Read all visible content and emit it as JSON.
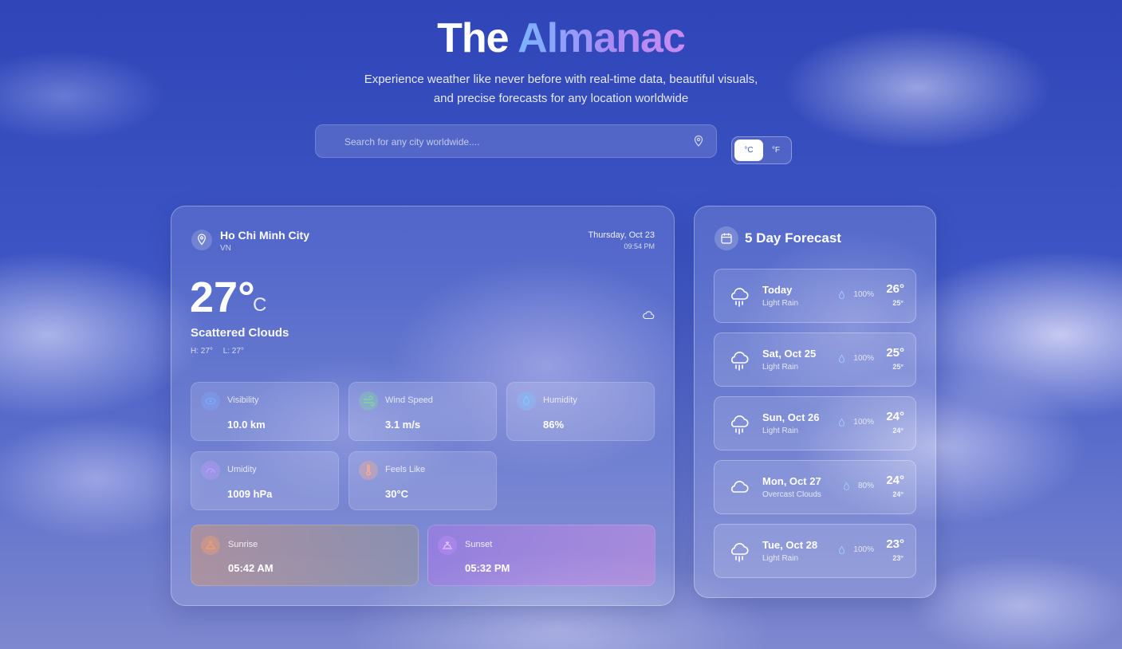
{
  "header": {
    "title_main": "The",
    "title_accent": "Almanac",
    "subtitle": "Experience weather like never before with real-time data, beautiful visuals, and precise forecasts for any location worldwide"
  },
  "search": {
    "placeholder": "Search for any city worldwide....",
    "value": "",
    "icon": "location-pin-icon"
  },
  "units": {
    "celsius": "°C",
    "fahrenheit": "°F",
    "selected": "°C"
  },
  "current": {
    "city": "Ho Chi Minh City",
    "country": "VN",
    "date": "Thursday, Oct 23",
    "time": "09:54 PM",
    "temperature": "27°",
    "unit": "C",
    "condition": "Scattered Clouds",
    "high": "H: 27°",
    "low": "L: 27°",
    "condition_icon": "cloud-icon"
  },
  "stats": [
    {
      "label": "Visibility",
      "value": "10.0 km",
      "icon": "eye-icon",
      "color": "#7fa8ff"
    },
    {
      "label": "Wind Speed",
      "value": "3.1 m/s",
      "icon": "wind-icon",
      "color": "#7fd6a0"
    },
    {
      "label": "Humidity",
      "value": "86%",
      "icon": "droplet-icon",
      "color": "#7fc7ff"
    },
    {
      "label": "Umidity",
      "value": "1009 hPa",
      "icon": "gauge-icon",
      "color": "#c49bff"
    },
    {
      "label": "Feels Like",
      "value": "30°C",
      "icon": "thermometer-icon",
      "color": "#ffb08a"
    }
  ],
  "sun": {
    "sunrise_label": "Sunrise",
    "sunrise_time": "05:42 AM",
    "sunset_label": "Sunset",
    "sunset_time": "05:32 PM",
    "sunrise_color": "#f0a070",
    "sunset_color": "#c48cff"
  },
  "forecast": {
    "title": "5 Day Forecast",
    "days": [
      {
        "day": "Today",
        "desc": "Light Rain",
        "rain": "100%",
        "high": "26°",
        "low": "25°",
        "icon": "cloud-rain-icon"
      },
      {
        "day": "Sat, Oct 25",
        "desc": "Light Rain",
        "rain": "100%",
        "high": "25°",
        "low": "25°",
        "icon": "cloud-rain-icon"
      },
      {
        "day": "Sun, Oct 26",
        "desc": "Light Rain",
        "rain": "100%",
        "high": "24°",
        "low": "24°",
        "icon": "cloud-rain-icon"
      },
      {
        "day": "Mon, Oct 27",
        "desc": "Overcast Clouds",
        "rain": "80%",
        "high": "24°",
        "low": "24°",
        "icon": "cloud-icon"
      },
      {
        "day": "Tue, Oct 28",
        "desc": "Light Rain",
        "rain": "100%",
        "high": "23°",
        "low": "23°",
        "icon": "cloud-rain-icon"
      }
    ]
  }
}
